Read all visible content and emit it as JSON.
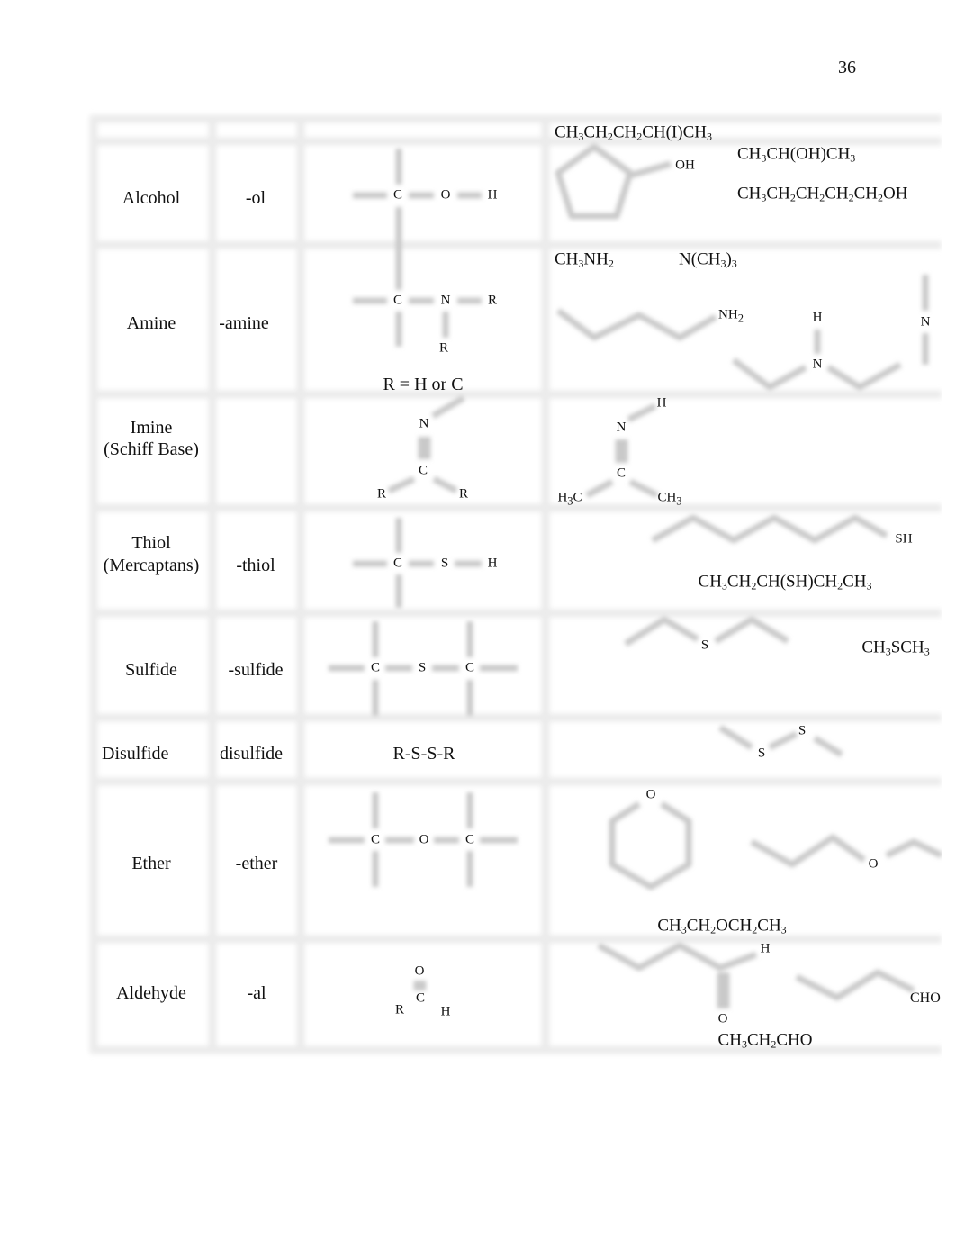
{
  "page_number": "36",
  "rows": [
    {
      "name": "Alcohol",
      "suffix": "-ol",
      "general": [
        "C",
        "O",
        "H"
      ],
      "examples": [
        "CH3CH2CH2CH(I)CH3",
        "OH",
        "CH3CH(OH)CH3",
        "CH3CH2CH2CH2CH2OH"
      ]
    },
    {
      "name": "Amine",
      "suffix": "-amine",
      "general": [
        "C",
        "N",
        "R",
        "R"
      ],
      "note": "R = H or C",
      "examples": [
        "CH3NH2",
        "N(CH3)3",
        "NH2",
        "H",
        "N",
        "N"
      ]
    },
    {
      "name": "Imine",
      "name2": "(Schiff Base)",
      "suffix": "",
      "general": [
        "N",
        "C",
        "R",
        "R"
      ],
      "examples": [
        "H",
        "N",
        "C",
        "H3C",
        "CH3"
      ]
    },
    {
      "name": "Thiol",
      "name2": "(Mercaptans)",
      "suffix": "-thiol",
      "general": [
        "C",
        "S",
        "H"
      ],
      "examples": [
        "SH",
        "CH3CH2CH(SH)CH2CH3"
      ]
    },
    {
      "name": "Sulfide",
      "suffix": "-sulfide",
      "general": [
        "C",
        "S",
        "C"
      ],
      "examples": [
        "S",
        "CH3SCH3"
      ]
    },
    {
      "name": "Disulfide",
      "suffix": "disulfide",
      "general": [
        "R-S-S-R"
      ],
      "examples": [
        "S",
        "S"
      ]
    },
    {
      "name": "Ether",
      "suffix": "-ether",
      "general": [
        "C",
        "O",
        "C"
      ],
      "examples": [
        "O",
        "O",
        "CH3CH2OCH2CH3"
      ]
    },
    {
      "name": "Aldehyde",
      "suffix": "-al",
      "general": [
        "O",
        "C",
        "R",
        "H"
      ],
      "examples": [
        "H",
        "CHO",
        "O",
        "CH3CH2CHO"
      ]
    }
  ]
}
